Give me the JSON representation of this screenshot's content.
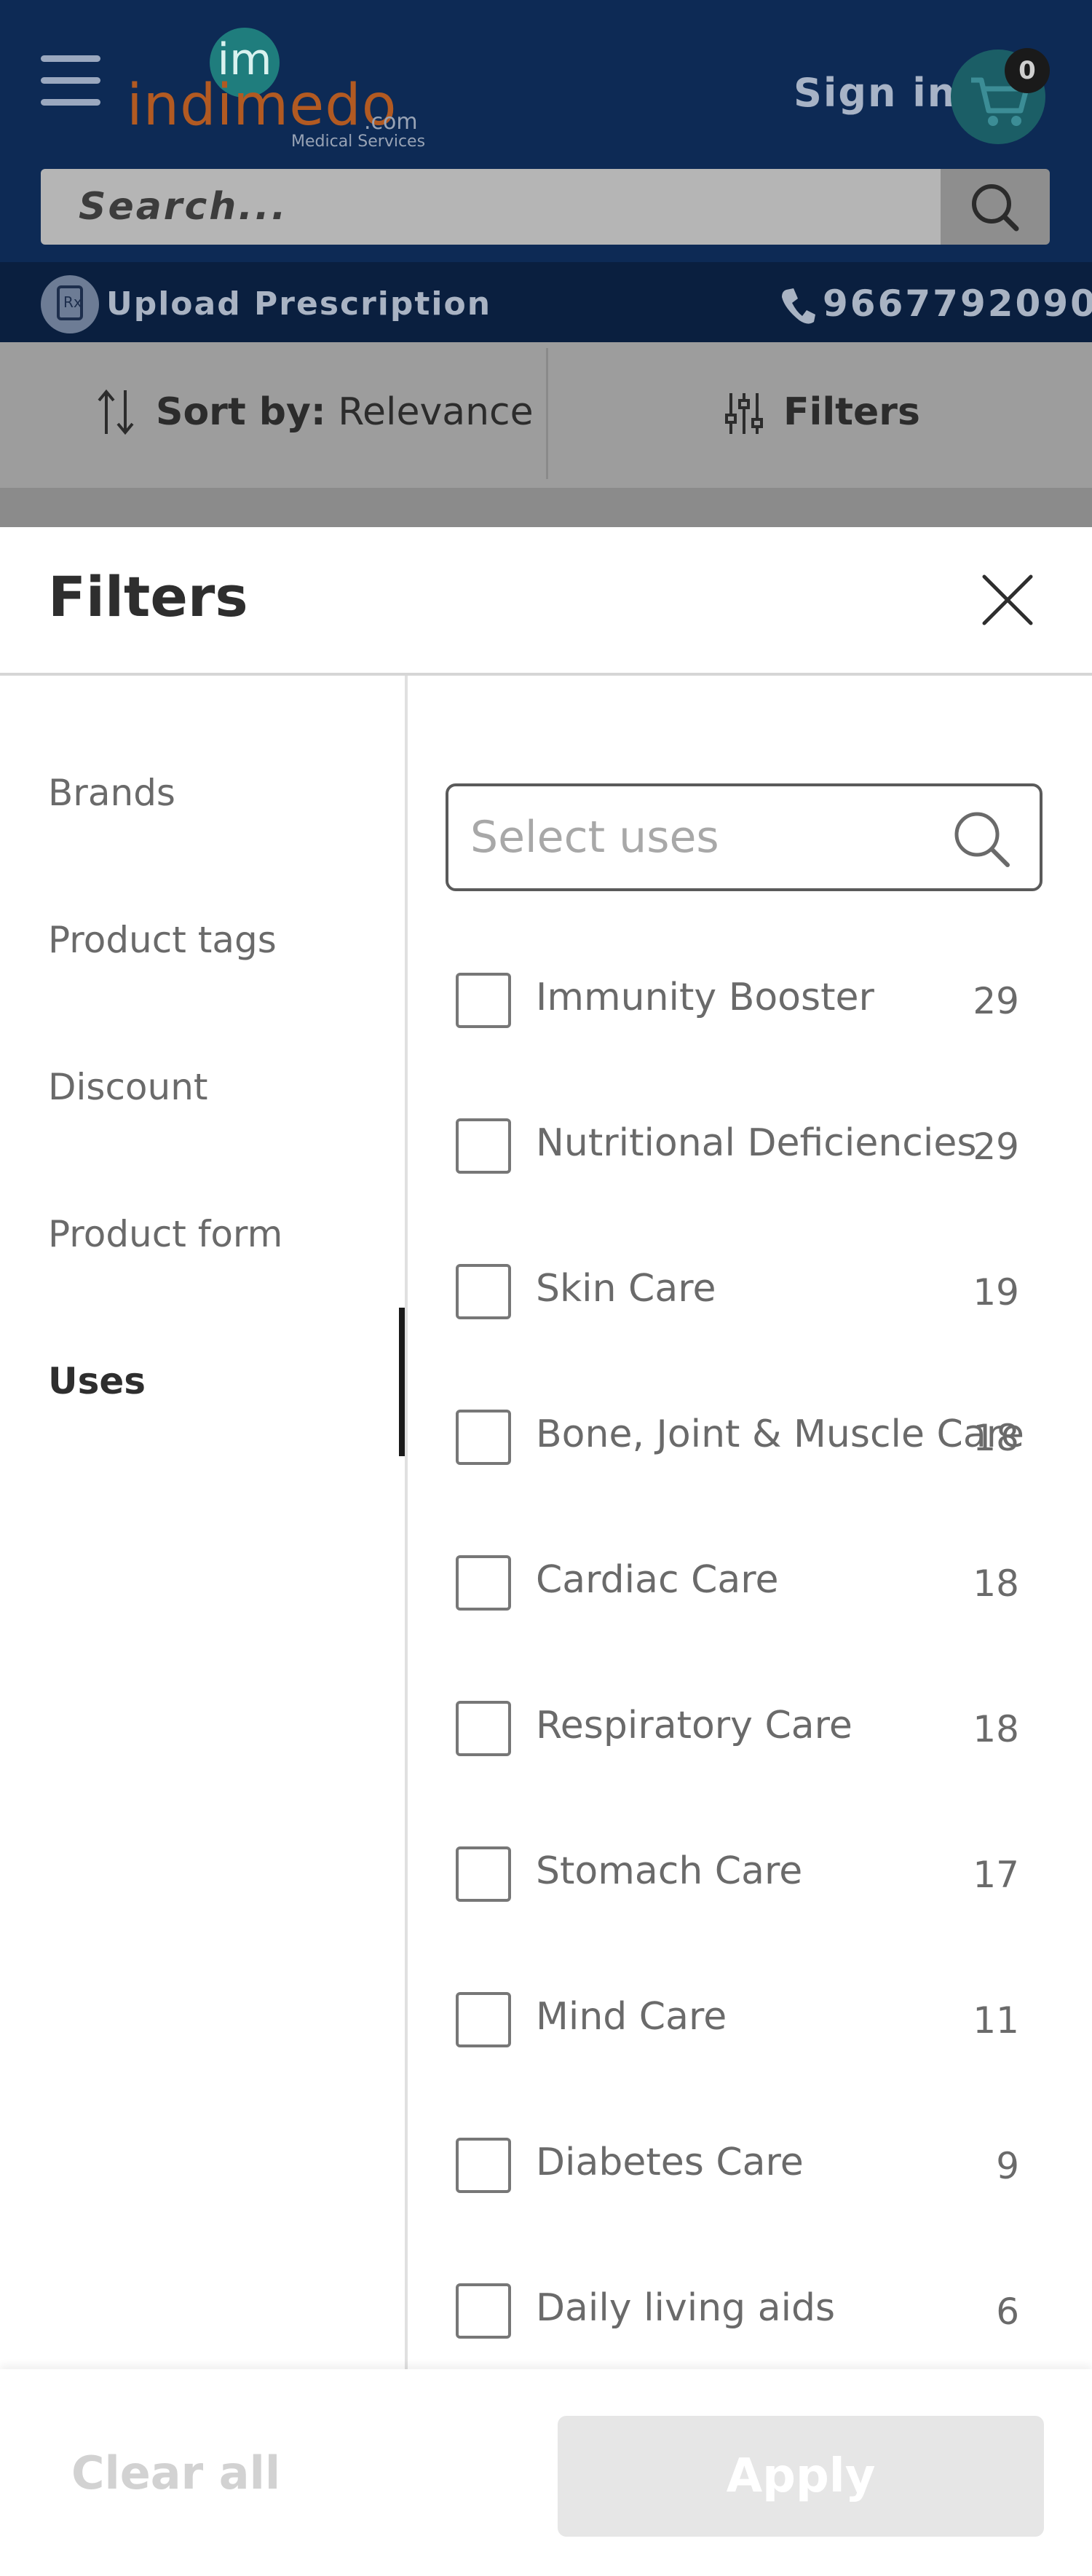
{
  "header": {
    "brand": "indimedo",
    "brand_suffix": ".com",
    "brand_tagline": "Medical Services",
    "brand_monogram": "im",
    "sign_in": "Sign in",
    "cart_count": "0",
    "search_placeholder": "Search...",
    "upload_label": "Upload Prescription",
    "phone": "9667792090"
  },
  "sort_bar": {
    "sort_prefix": "Sort by:",
    "sort_value": "Relevance",
    "filters_label": "Filters"
  },
  "panel": {
    "title": "Filters",
    "categories": [
      "Brands",
      "Product tags",
      "Discount",
      "Product form",
      "Uses"
    ],
    "active_category": "Uses",
    "search_placeholder": "Select uses",
    "options": [
      {
        "label": "Immunity Booster",
        "count": "29"
      },
      {
        "label": "Nutritional Deficiencies",
        "count": "29"
      },
      {
        "label": "Skin Care",
        "count": "19"
      },
      {
        "label": "Bone, Joint & Muscle Care",
        "count": "18"
      },
      {
        "label": "Cardiac Care",
        "count": "18"
      },
      {
        "label": "Respiratory Care",
        "count": "18"
      },
      {
        "label": "Stomach Care",
        "count": "17"
      },
      {
        "label": "Mind Care",
        "count": "11"
      },
      {
        "label": "Diabetes Care",
        "count": "9"
      },
      {
        "label": "Daily living aids",
        "count": "6"
      }
    ]
  },
  "footer": {
    "clear_all": "Clear all",
    "apply": "Apply"
  },
  "colors": {
    "header_bg": "#0d2a55",
    "brand_orange": "#b25a22",
    "brand_teal": "#1f7d7d",
    "overlay_gray": "#9d9d9d",
    "active_indicator": "#1a1a1a"
  }
}
